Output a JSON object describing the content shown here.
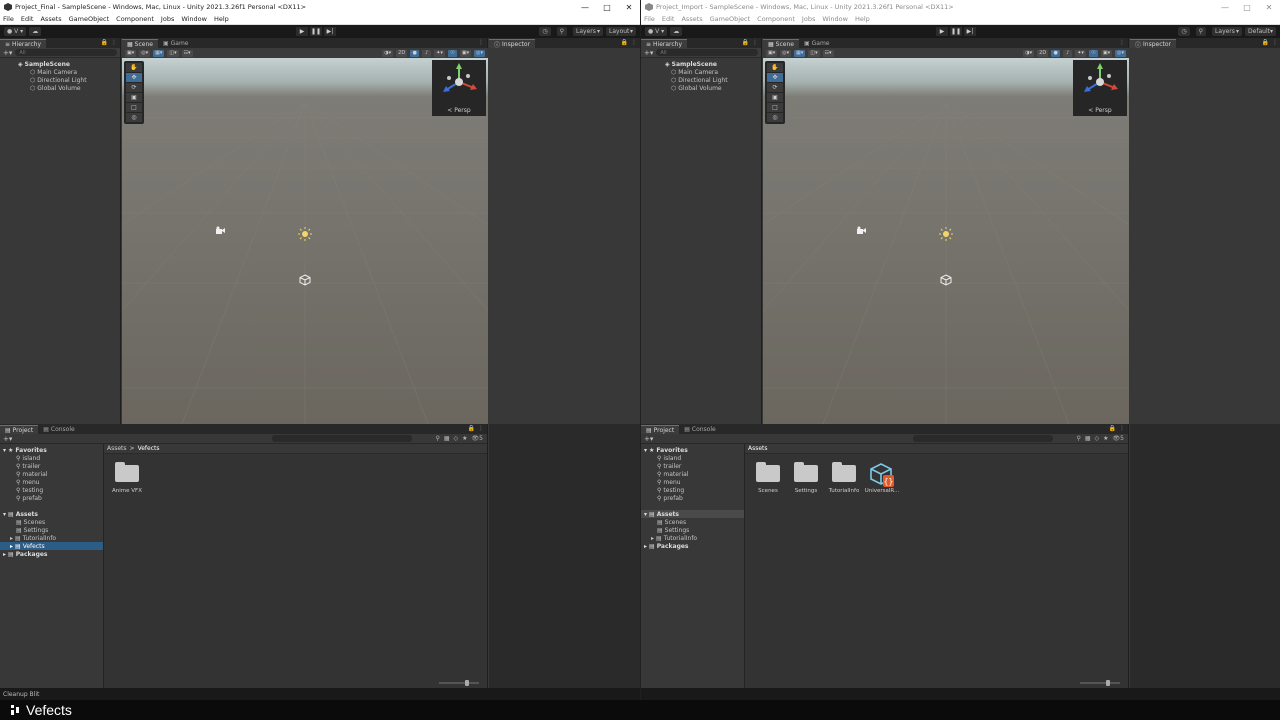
{
  "colors": {
    "selection": "#2c5d87",
    "accent": "#3a79bb",
    "panel": "#383838",
    "toolbar": "#191919"
  },
  "left": {
    "title": "Project_Final - SampleScene - Windows, Mac, Linux - Unity 2021.3.26f1 Personal <DX11>",
    "menu": [
      "File",
      "Edit",
      "Assets",
      "GameObject",
      "Component",
      "Jobs",
      "Window",
      "Help"
    ],
    "toolbar": {
      "account": "V",
      "layers": "Layers",
      "layout": "Layout"
    },
    "hierarchy": {
      "tab": "Hierarchy",
      "search_placeholder": "All",
      "scene": "SampleScene",
      "items": [
        "Main Camera",
        "Directional Light",
        "Global Volume"
      ]
    },
    "scene_tabs": [
      "Scene",
      "Game"
    ],
    "scene_toolbar_2d": "2D",
    "gizmo_label": "< Persp",
    "inspector_tab": "Inspector",
    "project": {
      "tabs": [
        "Project",
        "Console"
      ],
      "favorites_label": "Favorites",
      "favorites": [
        "island",
        "trailer",
        "material",
        "menu",
        "testing",
        "prefab"
      ],
      "assets_label": "Assets",
      "asset_folders": [
        "Scenes",
        "Settings",
        "TutorialInfo",
        "Vefects"
      ],
      "packages_label": "Packages",
      "breadcrumb": [
        "Assets",
        "Vefects"
      ],
      "grid": [
        "Anime VFX"
      ],
      "count": "5"
    },
    "status": "Cleanup Blit"
  },
  "right": {
    "title": "Project_Import - SampleScene - Windows, Mac, Linux - Unity 2021.3.26f1 Personal <DX11>",
    "menu": [
      "File",
      "Edit",
      "Assets",
      "GameObject",
      "Component",
      "Jobs",
      "Window",
      "Help"
    ],
    "toolbar": {
      "account": "V",
      "layers": "Layers",
      "layout": "Default"
    },
    "hierarchy": {
      "tab": "Hierarchy",
      "search_placeholder": "All",
      "scene": "SampleScene",
      "items": [
        "Main Camera",
        "Directional Light",
        "Global Volume"
      ]
    },
    "scene_tabs": [
      "Scene",
      "Game"
    ],
    "scene_toolbar_2d": "2D",
    "gizmo_label": "< Persp",
    "inspector_tab": "Inspector",
    "project": {
      "tabs": [
        "Project",
        "Console"
      ],
      "favorites_label": "Favorites",
      "favorites": [
        "island",
        "trailer",
        "material",
        "menu",
        "testing",
        "prefab"
      ],
      "assets_label": "Assets",
      "asset_folders": [
        "Scenes",
        "Settings",
        "TutorialInfo"
      ],
      "packages_label": "Packages",
      "breadcrumb": [
        "Assets"
      ],
      "grid": [
        "Scenes",
        "Settings",
        "TutorialInfo",
        "UniversalR..."
      ],
      "count": "5"
    }
  },
  "caption": "Vefects"
}
